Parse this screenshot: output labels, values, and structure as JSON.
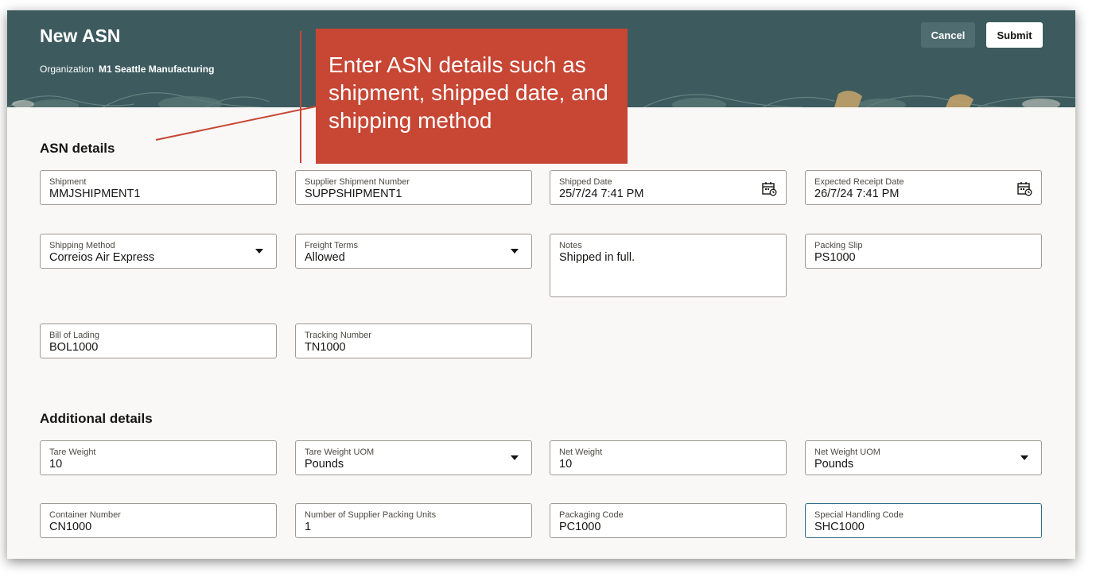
{
  "header": {
    "title": "New ASN",
    "org_label": "Organization",
    "org_value": "M1 Seattle Manufacturing",
    "cancel_label": "Cancel",
    "submit_label": "Submit"
  },
  "callout": {
    "text": "Enter ASN details such as shipment, shipped date, and shipping method"
  },
  "asn_details": {
    "title": "ASN details",
    "shipment": {
      "label": "Shipment",
      "value": "MMJSHIPMENT1"
    },
    "supplier_shipment_number": {
      "label": "Supplier Shipment Number",
      "value": "SUPPSHIPMENT1"
    },
    "shipped_date": {
      "label": "Shipped Date",
      "value": "25/7/24 7:41 PM"
    },
    "expected_receipt_date": {
      "label": "Expected Receipt Date",
      "value": "26/7/24 7:41 PM"
    },
    "shipping_method": {
      "label": "Shipping Method",
      "value": "Correios Air Express"
    },
    "freight_terms": {
      "label": "Freight Terms",
      "value": "Allowed"
    },
    "notes": {
      "label": "Notes",
      "value": "Shipped in full."
    },
    "packing_slip": {
      "label": "Packing Slip",
      "value": "PS1000"
    },
    "bill_of_lading": {
      "label": "Bill of Lading",
      "value": "BOL1000"
    },
    "tracking_number": {
      "label": "Tracking Number",
      "value": "TN1000"
    }
  },
  "additional_details": {
    "title": "Additional details",
    "tare_weight": {
      "label": "Tare Weight",
      "value": "10"
    },
    "tare_weight_uom": {
      "label": "Tare Weight UOM",
      "value": "Pounds"
    },
    "net_weight": {
      "label": "Net Weight",
      "value": "10"
    },
    "net_weight_uom": {
      "label": "Net Weight UOM",
      "value": "Pounds"
    },
    "container_number": {
      "label": "Container Number",
      "value": "CN1000"
    },
    "supplier_packing_units": {
      "label": "Number of Supplier Packing Units",
      "value": "1"
    },
    "packaging_code": {
      "label": "Packaging Code",
      "value": "PC1000"
    },
    "special_handling_code": {
      "label": "Special Handling Code",
      "value": "SHC1000"
    }
  },
  "icons": {
    "calendar": "calendar-icon",
    "dropdown": "chevron-down-icon"
  },
  "colors": {
    "header_bg": "#3d5b5f",
    "callout_bg": "#c74634",
    "focus_border": "#2f6f86"
  }
}
